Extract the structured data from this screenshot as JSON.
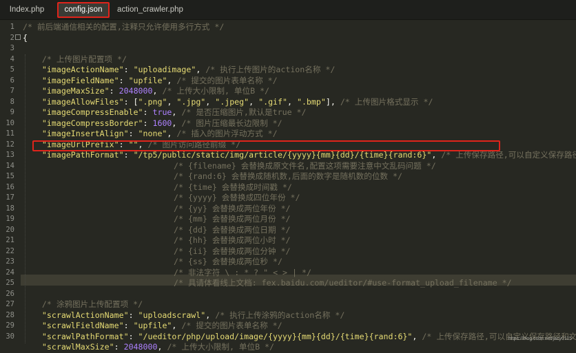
{
  "tabs": [
    {
      "label": "Index.php",
      "active": false
    },
    {
      "label": "config.json",
      "active": true
    },
    {
      "label": "action_crawler.php",
      "active": false
    }
  ],
  "line_numbers": [
    "1",
    "2",
    "3",
    "4",
    "5",
    "6",
    "7",
    "8",
    "9",
    "10",
    "11",
    "12",
    "13",
    "14",
    "15",
    "16",
    "17",
    "18",
    "19",
    "20",
    "21",
    "22",
    "23",
    "24",
    "25",
    "26",
    "27",
    "28",
    "29",
    "30"
  ],
  "lines": [
    {
      "n": 1,
      "cont": false,
      "parts": [
        {
          "c": "comment",
          "t": "/* 前后端通信相关的配置,注释只允许使用多行方式 */"
        }
      ]
    },
    {
      "n": 2,
      "cont": false,
      "parts": [
        {
          "c": "punc",
          "t": "{"
        }
      ]
    },
    {
      "n": 3,
      "cont": false,
      "parts": []
    },
    {
      "n": 4,
      "cont": false,
      "parts": [
        {
          "c": "punc",
          "t": "    "
        },
        {
          "c": "comment",
          "t": "/* 上传图片配置项 */"
        }
      ]
    },
    {
      "n": 5,
      "cont": false,
      "parts": [
        {
          "c": "punc",
          "t": "    "
        },
        {
          "c": "key",
          "t": "\"imageActionName\""
        },
        {
          "c": "punc",
          "t": ": "
        },
        {
          "c": "str",
          "t": "\"uploadimage\""
        },
        {
          "c": "punc",
          "t": ", "
        },
        {
          "c": "comment",
          "t": "/* 执行上传图片的action名称 */"
        }
      ]
    },
    {
      "n": 6,
      "cont": false,
      "parts": [
        {
          "c": "punc",
          "t": "    "
        },
        {
          "c": "key",
          "t": "\"imageFieldName\""
        },
        {
          "c": "punc",
          "t": ": "
        },
        {
          "c": "str",
          "t": "\"upfile\""
        },
        {
          "c": "punc",
          "t": ", "
        },
        {
          "c": "comment",
          "t": "/* 提交的图片表单名称 */"
        }
      ]
    },
    {
      "n": 7,
      "cont": false,
      "parts": [
        {
          "c": "punc",
          "t": "    "
        },
        {
          "c": "key",
          "t": "\"imageMaxSize\""
        },
        {
          "c": "punc",
          "t": ": "
        },
        {
          "c": "num",
          "t": "2048000"
        },
        {
          "c": "punc",
          "t": ", "
        },
        {
          "c": "comment",
          "t": "/* 上传大小限制, 单位B */"
        }
      ]
    },
    {
      "n": 8,
      "cont": false,
      "parts": [
        {
          "c": "punc",
          "t": "    "
        },
        {
          "c": "key",
          "t": "\"imageAllowFiles\""
        },
        {
          "c": "punc",
          "t": ": ["
        },
        {
          "c": "str",
          "t": "\".png\""
        },
        {
          "c": "punc",
          "t": ", "
        },
        {
          "c": "str",
          "t": "\".jpg\""
        },
        {
          "c": "punc",
          "t": ", "
        },
        {
          "c": "str",
          "t": "\".jpeg\""
        },
        {
          "c": "punc",
          "t": ", "
        },
        {
          "c": "str",
          "t": "\".gif\""
        },
        {
          "c": "punc",
          "t": ", "
        },
        {
          "c": "str",
          "t": "\".bmp\""
        },
        {
          "c": "punc",
          "t": "], "
        },
        {
          "c": "comment",
          "t": "/* 上传图片格式显示 */"
        }
      ]
    },
    {
      "n": 9,
      "cont": false,
      "parts": [
        {
          "c": "punc",
          "t": "    "
        },
        {
          "c": "key",
          "t": "\"imageCompressEnable\""
        },
        {
          "c": "punc",
          "t": ": "
        },
        {
          "c": "bool",
          "t": "true"
        },
        {
          "c": "punc",
          "t": ", "
        },
        {
          "c": "comment",
          "t": "/* 是否压缩图片,默认是true */"
        }
      ]
    },
    {
      "n": 10,
      "cont": false,
      "parts": [
        {
          "c": "punc",
          "t": "    "
        },
        {
          "c": "key",
          "t": "\"imageCompressBorder\""
        },
        {
          "c": "punc",
          "t": ": "
        },
        {
          "c": "num",
          "t": "1600"
        },
        {
          "c": "punc",
          "t": ", "
        },
        {
          "c": "comment",
          "t": "/* 图片压缩最长边限制 */"
        }
      ]
    },
    {
      "n": 11,
      "cont": false,
      "parts": [
        {
          "c": "punc",
          "t": "    "
        },
        {
          "c": "key",
          "t": "\"imageInsertAlign\""
        },
        {
          "c": "punc",
          "t": ": "
        },
        {
          "c": "str",
          "t": "\"none\""
        },
        {
          "c": "punc",
          "t": ", "
        },
        {
          "c": "comment",
          "t": "/* 插入的图片浮动方式 */"
        }
      ]
    },
    {
      "n": 12,
      "cont": false,
      "parts": [
        {
          "c": "punc",
          "t": "    "
        },
        {
          "c": "key",
          "t": "\"imageUrlPrefix\""
        },
        {
          "c": "punc",
          "t": ": "
        },
        {
          "c": "str",
          "t": "\"\""
        },
        {
          "c": "punc",
          "t": ", "
        },
        {
          "c": "comment",
          "t": "/* 图片访问路径前缀 */"
        }
      ]
    },
    {
      "n": 13,
      "cont": false,
      "parts": [
        {
          "c": "punc",
          "t": "    "
        },
        {
          "c": "key",
          "t": "\"imagePathFormat\""
        },
        {
          "c": "punc",
          "t": ": "
        },
        {
          "c": "str",
          "t": "\"/tp5/public/static/img/article/{yyyy}{mm}{dd}/{time}{rand:6}\""
        },
        {
          "c": "punc",
          "t": ", "
        },
        {
          "c": "comment",
          "t": "/* 上传保存路径,可以自定义保存路径和"
        }
      ]
    },
    {
      "n": 14,
      "cont": true,
      "parts": [
        {
          "c": "comment",
          "t": "/* {filename} 会替换成原文件名,配置这项需要注意中文乱码问题 */"
        }
      ]
    },
    {
      "n": 15,
      "cont": true,
      "parts": [
        {
          "c": "comment",
          "t": "/* {rand:6} 会替换成随机数,后面的数字是随机数的位数 */"
        }
      ]
    },
    {
      "n": 16,
      "cont": true,
      "parts": [
        {
          "c": "comment",
          "t": "/* {time} 会替换成时间戳 */"
        }
      ]
    },
    {
      "n": 17,
      "cont": true,
      "parts": [
        {
          "c": "comment",
          "t": "/* {yyyy} 会替换成四位年份 */"
        }
      ]
    },
    {
      "n": 18,
      "cont": true,
      "parts": [
        {
          "c": "comment",
          "t": "/* {yy} 会替换成两位年份 */"
        }
      ]
    },
    {
      "n": 19,
      "cont": true,
      "parts": [
        {
          "c": "comment",
          "t": "/* {mm} 会替换成两位月份 */"
        }
      ]
    },
    {
      "n": 20,
      "cont": true,
      "parts": [
        {
          "c": "comment",
          "t": "/* {dd} 会替换成两位日期 */"
        }
      ]
    },
    {
      "n": 21,
      "cont": true,
      "parts": [
        {
          "c": "comment",
          "t": "/* {hh} 会替换成两位小时 */"
        }
      ]
    },
    {
      "n": 22,
      "cont": true,
      "parts": [
        {
          "c": "comment",
          "t": "/* {ii} 会替换成两位分钟 */"
        }
      ]
    },
    {
      "n": 23,
      "cont": true,
      "parts": [
        {
          "c": "comment",
          "t": "/* {ss} 会替换成两位秒 */"
        }
      ]
    },
    {
      "n": 24,
      "cont": true,
      "parts": [
        {
          "c": "comment",
          "t": "/* 非法字符 \\ : * ? \" < > | */"
        }
      ]
    },
    {
      "n": 25,
      "cont": true,
      "parts": [
        {
          "c": "comment",
          "t": "/* 具请体看线上文档: fex.baidu.com/ueditor/#use-format_upload_filename */"
        }
      ]
    },
    {
      "n": 26,
      "cont": false,
      "parts": []
    },
    {
      "n": 27,
      "cont": false,
      "parts": [
        {
          "c": "punc",
          "t": "    "
        },
        {
          "c": "comment",
          "t": "/* 涂鸦图片上传配置项 */"
        }
      ]
    },
    {
      "n": 28,
      "cont": false,
      "parts": [
        {
          "c": "punc",
          "t": "    "
        },
        {
          "c": "key",
          "t": "\"scrawlActionName\""
        },
        {
          "c": "punc",
          "t": ": "
        },
        {
          "c": "str",
          "t": "\"uploadscrawl\""
        },
        {
          "c": "punc",
          "t": ", "
        },
        {
          "c": "comment",
          "t": "/* 执行上传涂鸦的action名称 */"
        }
      ]
    },
    {
      "n": 29,
      "cont": false,
      "parts": [
        {
          "c": "punc",
          "t": "    "
        },
        {
          "c": "key",
          "t": "\"scrawlFieldName\""
        },
        {
          "c": "punc",
          "t": ": "
        },
        {
          "c": "str",
          "t": "\"upfile\""
        },
        {
          "c": "punc",
          "t": ", "
        },
        {
          "c": "comment",
          "t": "/* 提交的图片表单名称 */"
        }
      ]
    },
    {
      "n": 30,
      "cont": false,
      "parts": [
        {
          "c": "punc",
          "t": "    "
        },
        {
          "c": "key",
          "t": "\"scrawlPathFormat\""
        },
        {
          "c": "punc",
          "t": ": "
        },
        {
          "c": "str",
          "t": "\"/ueditor/php/upload/image/{yyyy}{mm}{dd}/{time}{rand:6}\""
        },
        {
          "c": "punc",
          "t": ", "
        },
        {
          "c": "comment",
          "t": "/* 上传保存路径,可以自定义保存路径和文件"
        }
      ]
    },
    {
      "n": 31,
      "cont": false,
      "parts": [
        {
          "c": "punc",
          "t": "    "
        },
        {
          "c": "key",
          "t": "\"scrawlMaxSize\""
        },
        {
          "c": "punc",
          "t": ": "
        },
        {
          "c": "num",
          "t": "2048000"
        },
        {
          "c": "punc",
          "t": ", "
        },
        {
          "c": "comment",
          "t": "/* 上传大小限制, 单位B */"
        }
      ]
    }
  ],
  "watermark": "https://blog.csdn.net/jacy0115",
  "colors": {
    "background": "#272822",
    "comment": "#75715e",
    "string": "#e6db74",
    "number": "#ae81ff",
    "highlight": "#e0241b"
  }
}
